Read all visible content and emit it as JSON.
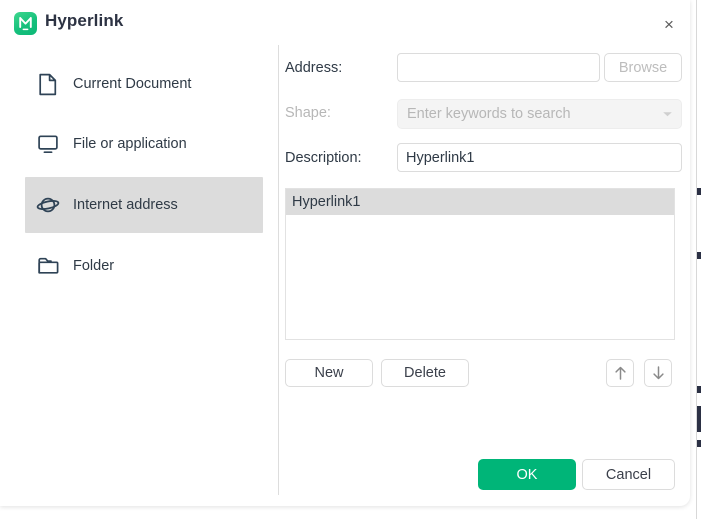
{
  "window": {
    "title": "Hyperlink",
    "app_icon": "app-logo-icon",
    "close_label": "×"
  },
  "sidebar": {
    "items": [
      {
        "label": "Current Document",
        "icon": "document-icon",
        "selected": false
      },
      {
        "label": "File or application",
        "icon": "monitor-icon",
        "selected": false
      },
      {
        "label": "Internet address",
        "icon": "globe-icon",
        "selected": true
      },
      {
        "label": "Folder",
        "icon": "folder-icon",
        "selected": false
      }
    ]
  },
  "form": {
    "address": {
      "label": "Address:",
      "value": "",
      "placeholder": "",
      "browse_label": "Browse",
      "browse_disabled": true
    },
    "shape": {
      "label": "Shape:",
      "value": "",
      "placeholder": "Enter keywords to search",
      "disabled": true,
      "dropdown_icon": "chevron-down-icon"
    },
    "description": {
      "label": "Description:",
      "value": "Hyperlink1"
    }
  },
  "list": {
    "items": [
      {
        "label": "Hyperlink1",
        "selected": true
      }
    ]
  },
  "list_toolbar": {
    "new_label": "New",
    "delete_label": "Delete",
    "move_up_icon": "arrow-up-icon",
    "move_down_icon": "arrow-down-icon"
  },
  "footer": {
    "ok_label": "OK",
    "cancel_label": "Cancel"
  },
  "colors": {
    "accent": "#00b578",
    "selection": "#dcdcdc",
    "title_text": "#2d3343",
    "body_text": "#2f3a46",
    "muted_text": "#b7b7b7",
    "border": "#dcdcdc"
  }
}
